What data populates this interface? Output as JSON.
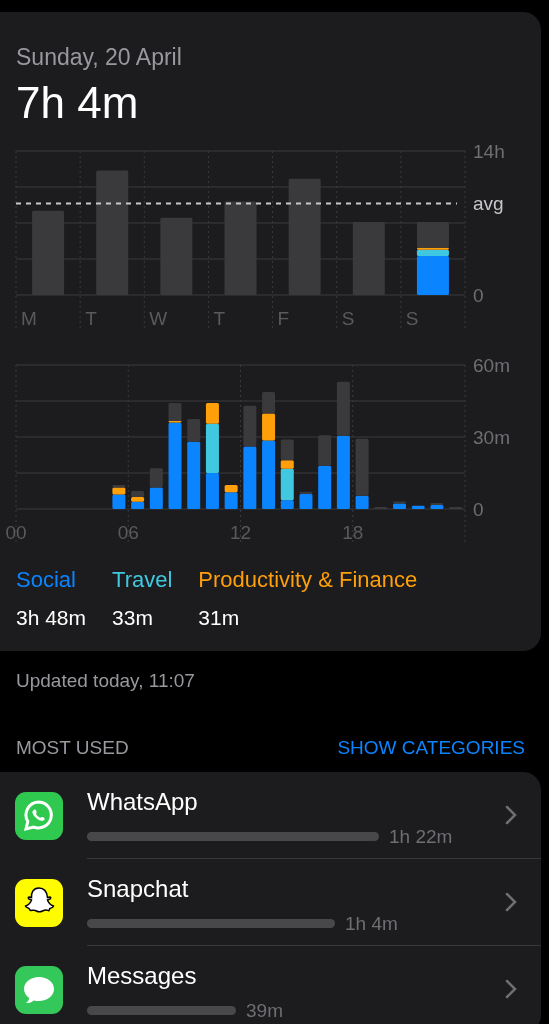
{
  "summary": {
    "date": "Sunday, 20 April",
    "total": "7h 4m"
  },
  "week_chart": {
    "chart_data": {
      "type": "bar",
      "stacked": true,
      "categories": [
        "M",
        "T",
        "W",
        "T",
        "F",
        "S",
        "S"
      ],
      "grid": true,
      "ylim": [
        0,
        14
      ],
      "yticks": [
        0,
        {
          "value": 14,
          "label": "14h"
        }
      ],
      "ref_lines": [
        {
          "axis": "y",
          "value": 8.9,
          "label": "avg"
        }
      ],
      "series": [
        {
          "color": "#0a84ff",
          "values": [
            null,
            null,
            null,
            null,
            null,
            null,
            3.8
          ]
        },
        {
          "color": "#40c8e0",
          "values": [
            null,
            null,
            null,
            null,
            null,
            null,
            0.6
          ]
        },
        {
          "color": "#ff9f0a",
          "values": [
            null,
            null,
            null,
            null,
            null,
            null,
            0.2
          ]
        },
        {
          "color": "#3a3a3c",
          "values": [
            8.2,
            12.1,
            7.5,
            9.1,
            11.3,
            7.1,
            2.5
          ]
        }
      ]
    }
  },
  "hour_chart": {
    "chart_data": {
      "type": "bar",
      "stacked": true,
      "x": [
        0.5,
        1.5,
        2.5,
        3.5,
        4.5,
        5.5,
        6.5,
        7.5,
        8.5,
        9.5,
        10.5,
        11.5,
        12.5,
        13.5,
        14.5,
        15.5,
        16.5,
        17.5,
        18.5,
        19.5,
        20.5,
        21.5,
        22.5,
        23.5
      ],
      "xlim": [
        0,
        24
      ],
      "grid": true,
      "xticks": [
        {
          "value": 0,
          "label": "00"
        },
        {
          "value": 6,
          "label": "06"
        },
        {
          "value": 12,
          "label": "12"
        },
        {
          "value": 18,
          "label": "18"
        }
      ],
      "ylim": [
        0,
        60
      ],
      "yticks": [
        0,
        {
          "value": 30,
          "label": "30m"
        },
        {
          "value": 60,
          "label": "60m"
        }
      ],
      "series": [
        {
          "name": "Social",
          "color": "#0a84ff",
          "values": [
            0,
            0,
            0,
            0,
            0,
            6,
            3,
            9,
            36,
            28,
            15,
            7,
            26,
            28.5,
            3.6,
            6.2,
            18,
            30.5,
            5.5,
            0,
            2.3,
            1.4,
            1.7,
            0
          ]
        },
        {
          "name": "Travel",
          "color": "#40c8e0",
          "values": [
            0,
            0,
            0,
            0,
            0,
            0,
            0,
            0,
            0,
            0,
            20.5,
            0,
            0,
            0,
            13.2,
            0,
            0,
            0,
            0,
            0,
            0,
            0,
            0,
            0
          ]
        },
        {
          "name": "Productivity & Finance",
          "color": "#ff9f0a",
          "values": [
            0,
            0,
            0,
            0,
            0,
            3,
            2,
            0,
            0.7,
            0,
            8.7,
            3,
            0,
            11.3,
            3.5,
            0,
            0,
            0,
            0,
            0,
            0,
            0,
            0,
            0
          ]
        },
        {
          "color": "#3a3a3c",
          "values": [
            0,
            0,
            0,
            0,
            0,
            1,
            2.5,
            8,
            7.5,
            9.5,
            0,
            0,
            17,
            9,
            8.7,
            1,
            12.7,
            22.5,
            23.8,
            0.7,
            0.5,
            0,
            0.7,
            0.7
          ]
        }
      ]
    }
  },
  "category_totals": [
    "3h 48m",
    "33m",
    "31m"
  ],
  "updated": "Updated today, 11:07",
  "most_used": {
    "title": "MOST USED",
    "action": "SHOW CATEGORIES"
  },
  "apps": [
    {
      "kind": "whatsapp",
      "name": "WhatsApp",
      "time": "1h 22m"
    },
    {
      "kind": "snapchat",
      "name": "Snapchat",
      "time": "1h 4m"
    },
    {
      "kind": "messages",
      "name": "Messages",
      "time": "39m"
    }
  ]
}
